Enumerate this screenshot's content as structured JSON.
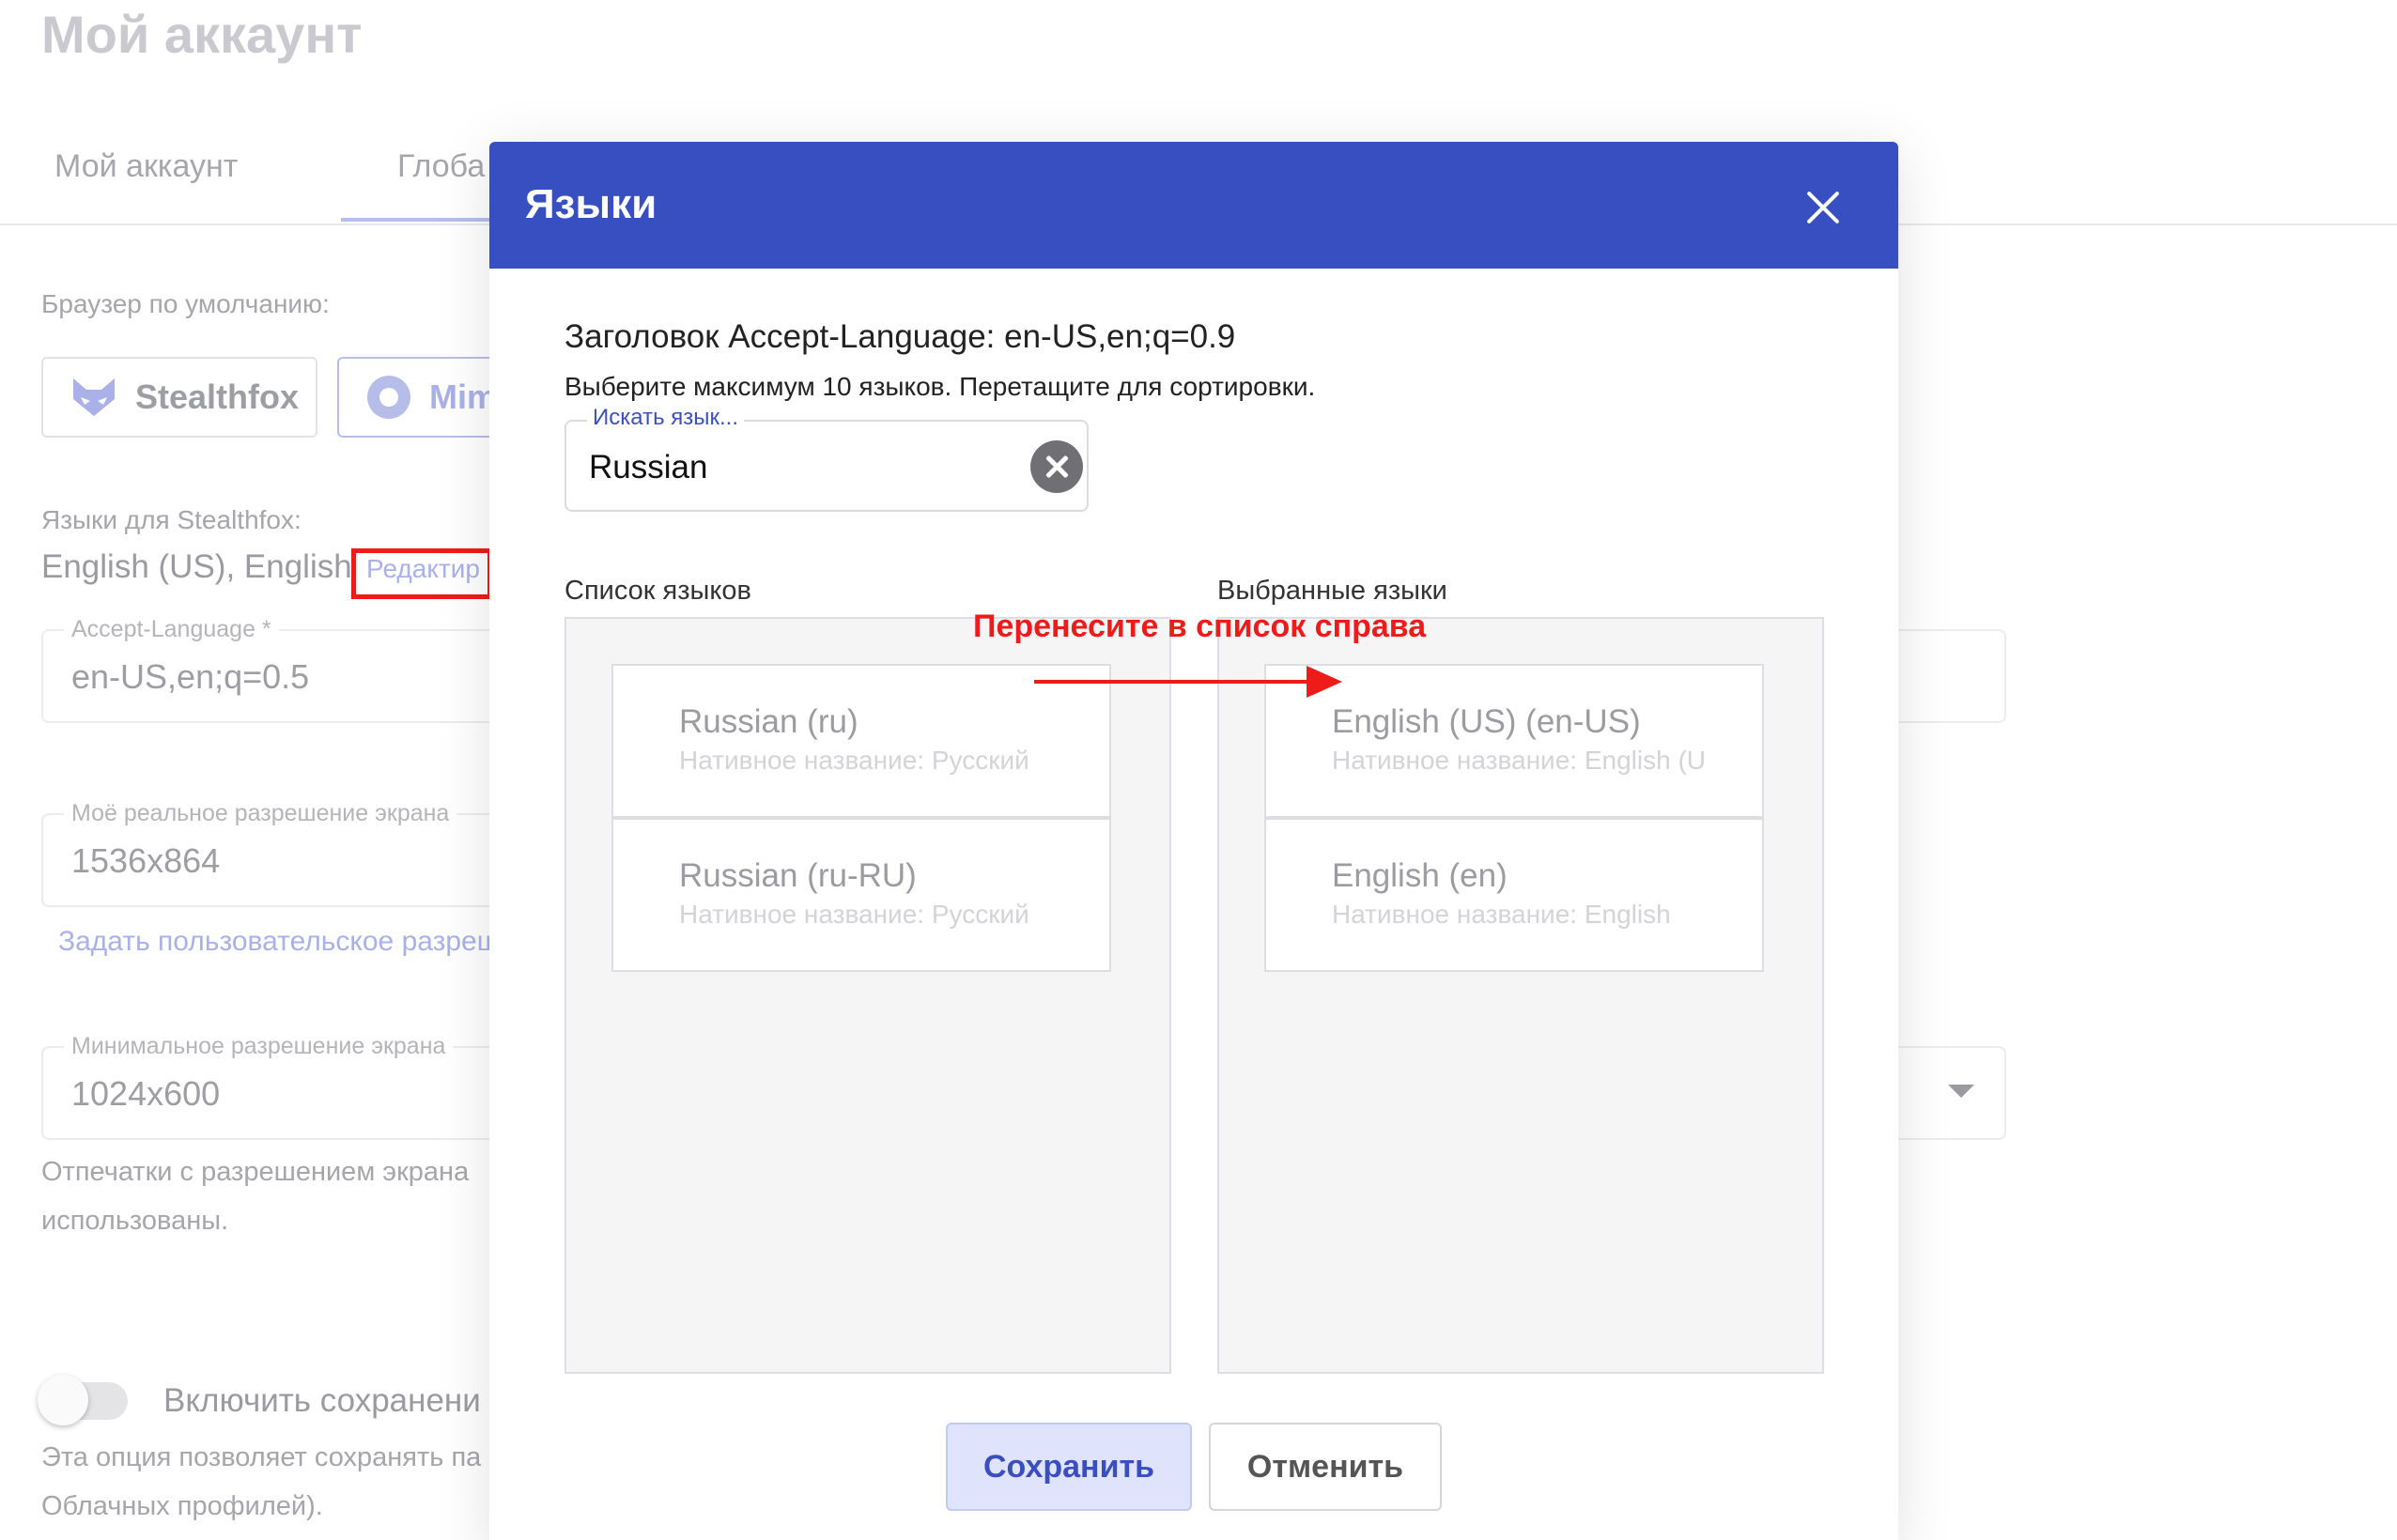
{
  "page": {
    "title": "Мой аккаунт",
    "tabs": [
      {
        "label": "Мой аккаунт"
      },
      {
        "label": "Глоба"
      }
    ],
    "default_browser_label": "Браузер по умолчанию:",
    "browsers": [
      {
        "label": "Stealthfox",
        "icon": "fox-icon"
      },
      {
        "label": "Mim",
        "icon": "mimic-icon"
      }
    ],
    "languages_label": "Языки для Stealthfox:",
    "languages_value": "English (US), English",
    "edit_link": "Редактир",
    "accept_language_field": {
      "label": "Accept-Language *",
      "value": "en-US,en;q=0.5"
    },
    "resolution_field": {
      "label": "Моё реальное разрешение экрана",
      "value": "1536x864"
    },
    "custom_resolution_link": "Задать пользовательское разреш",
    "min_resolution_field": {
      "label": "Минимальное разрешение экрана",
      "value": "1024x600"
    },
    "min_resolution_note_1": "Отпечатки с разрешением экрана",
    "min_resolution_note_2": "использованы.",
    "toggle_label": "Включить сохранени",
    "toggle_note_1": "Эта опция позволяет сохранять па",
    "toggle_note_2": "Облачных профилей)."
  },
  "modal": {
    "title": "Языки",
    "accept_language_header": "Заголовок Accept-Language: en-US,en;q=0.9",
    "hint": "Выберите максимум 10 языков. Перетащите для сортировки.",
    "search": {
      "label": "Искать язык...",
      "value": "Russian"
    },
    "available_title": "Список языков",
    "selected_title": "Выбранные языки",
    "available": [
      {
        "name": "Russian (ru)",
        "native": "Нативное название: Русский"
      },
      {
        "name": "Russian (ru-RU)",
        "native": "Нативное название: Русский"
      }
    ],
    "selected": [
      {
        "name": "English (US) (en-US)",
        "native": "Нативное название: English (U"
      },
      {
        "name": "English (en)",
        "native": "Нативное название: English"
      }
    ],
    "annotation": "Перенесите в список справа",
    "save_label": "Сохранить",
    "cancel_label": "Отменить"
  },
  "colors": {
    "modal_header": "#384fc1",
    "annotation": "#ee1b1b",
    "accent": "#3c50c2"
  }
}
